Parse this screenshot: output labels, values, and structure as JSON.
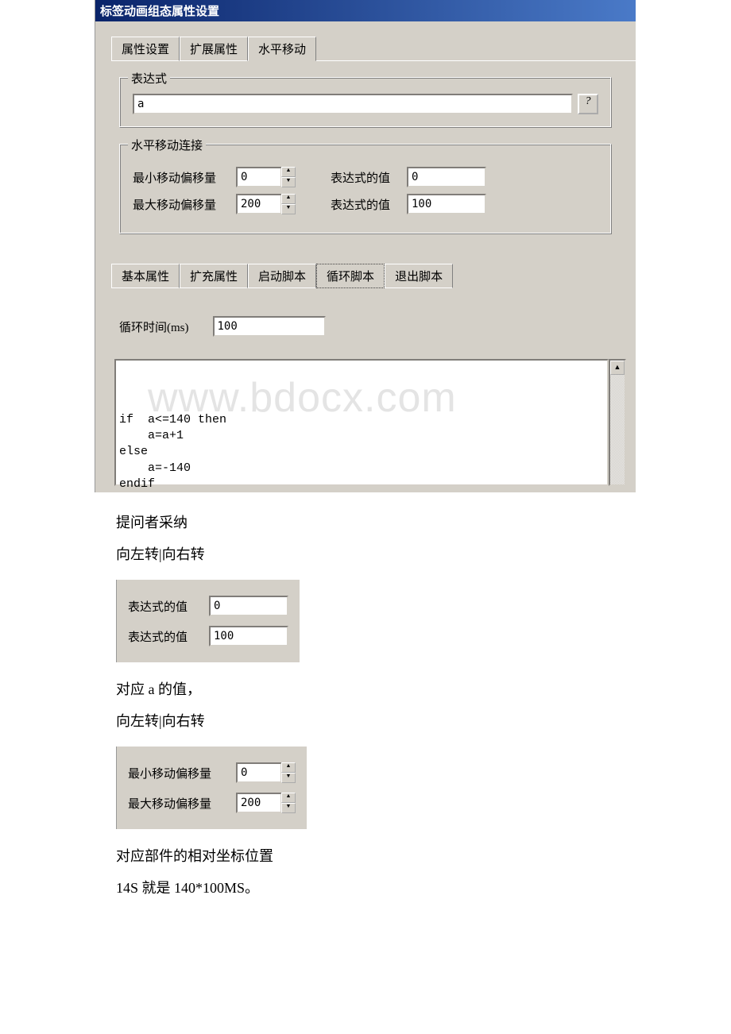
{
  "dialog": {
    "title": "标签动画组态属性设置",
    "top_tabs": {
      "tab1": "属性设置",
      "tab2": "扩展属性",
      "tab3": "水平移动"
    },
    "expression": {
      "legend": "表达式",
      "value": "a",
      "help": "?"
    },
    "move_connect": {
      "legend": "水平移动连接",
      "min_offset_label": "最小移动偏移量",
      "min_offset_value": "0",
      "min_expr_label": "表达式的值",
      "min_expr_value": "0",
      "max_offset_label": "最大移动偏移量",
      "max_offset_value": "200",
      "max_expr_label": "表达式的值",
      "max_expr_value": "100"
    },
    "bottom_tabs": {
      "tab1": "基本属性",
      "tab2": "扩充属性",
      "tab3": "启动脚本",
      "tab4": "循环脚本",
      "tab5": "退出脚本"
    },
    "loop": {
      "label": "循环时间(ms)",
      "value": "100"
    },
    "script": "if  a<=140 then\n    a=a+1\nelse\n    a=-140\nendif",
    "watermark": "www.bdocx.com"
  },
  "answer": {
    "accepted": "提问者采纳",
    "rotate": "向左转|向右转",
    "expr_panel": {
      "row1_label": "表达式的值",
      "row1_value": "0",
      "row2_label": "表达式的值",
      "row2_value": "100"
    },
    "correspond_a": "对应 a 的值，",
    "offset_panel": {
      "row1_label": "最小移动偏移量",
      "row1_value": "0",
      "row2_label": "最大移动偏移量",
      "row2_value": "200"
    },
    "coord_text": "对应部件的相对坐标位置",
    "final_text": "14S 就是 140*100MS。"
  }
}
